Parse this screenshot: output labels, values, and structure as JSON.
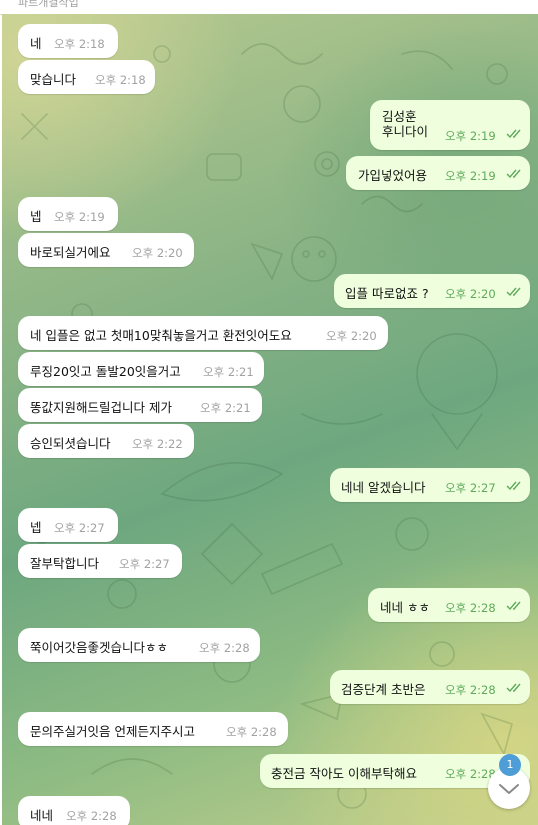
{
  "header": {
    "partial_text": "파르개켤삭업"
  },
  "messages": [
    {
      "side": "in",
      "text": "네",
      "time": "오후 2:18"
    },
    {
      "side": "in",
      "text": "맞습니다",
      "time": "오후 2:18"
    },
    {
      "side": "out",
      "text": "김성훈\n후니다이",
      "time": "오후 2:19",
      "read": true
    },
    {
      "side": "out",
      "text": "가입넣었어용",
      "time": "오후 2:19",
      "read": true
    },
    {
      "side": "in",
      "text": "넵",
      "time": "오후 2:19"
    },
    {
      "side": "in",
      "text": "바로되실거에요",
      "time": "오후 2:20"
    },
    {
      "side": "out",
      "text": "입플 따로없죠 ?",
      "time": "오후 2:20",
      "read": true
    },
    {
      "side": "in",
      "text": "네 입플은 없고 첫매10맞춰놓을거고 환전잇어도요",
      "time": "오후 2:20"
    },
    {
      "side": "in",
      "text": "루징20잇고 돌발20잇을거고",
      "time": "오후 2:21"
    },
    {
      "side": "in",
      "text": "똥값지원해드릴겁니다 제가",
      "time": "오후 2:21"
    },
    {
      "side": "in",
      "text": "승인되셧습니다",
      "time": "오후 2:22"
    },
    {
      "side": "out",
      "text": "네네 알겠습니다",
      "time": "오후 2:27",
      "read": true
    },
    {
      "side": "in",
      "text": "넵",
      "time": "오후 2:27"
    },
    {
      "side": "in",
      "text": "잘부탁합니다",
      "time": "오후 2:27"
    },
    {
      "side": "out",
      "text": "네네 ㅎㅎ",
      "time": "오후 2:28",
      "read": true
    },
    {
      "side": "in",
      "text": "쭉이어갓음좋겟습니다ㅎㅎ",
      "time": "오후 2:28"
    },
    {
      "side": "out",
      "text": "검증단계 초반은",
      "time": "오후 2:28",
      "read": true
    },
    {
      "side": "in",
      "text": "문의주실거잇음 언제든지주시고",
      "time": "오후 2:28"
    },
    {
      "side": "out",
      "text": "충전금 작아도 이해부탁해요",
      "time": "오후 2:28"
    },
    {
      "side": "in",
      "text": "네네",
      "time": "오후 2:28"
    }
  ],
  "scroll_down": {
    "icon": "chevron-down-icon",
    "unread_count": "1"
  },
  "colors": {
    "incoming": "#ffffff",
    "outgoing": "#efffde",
    "read_check": "#5fa95a",
    "badge": "#4e9dd6"
  }
}
